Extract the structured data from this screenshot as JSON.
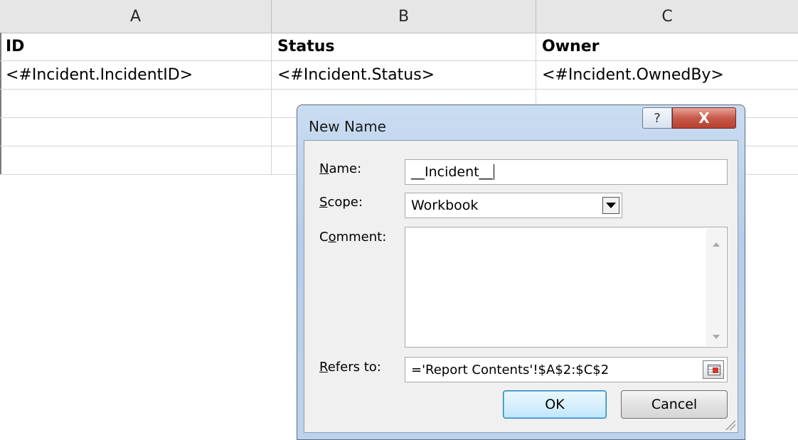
{
  "spreadsheet": {
    "columns": [
      "A",
      "B",
      "C"
    ],
    "header_row": [
      "ID",
      "Status",
      "Owner"
    ],
    "data_row": [
      "<#Incident.IncidentID>",
      "<#Incident.Status>",
      "<#Incident.OwnedBy>"
    ]
  },
  "dialog": {
    "title": "New Name",
    "help_glyph": "?",
    "close_glyph": "X",
    "name_label": {
      "accel": "N",
      "rest": "ame:"
    },
    "name_value": "__Incident__",
    "scope_label": {
      "accel": "S",
      "rest": "cope:"
    },
    "scope_value": "Workbook",
    "comment_label": {
      "pre": "C",
      "accel": "o",
      "rest": "mment:"
    },
    "comment_value": "",
    "refers_label": {
      "accel": "R",
      "rest": "efers to:"
    },
    "refers_value": "='Report Contents'!$A$2:$C$2",
    "ok_label": "OK",
    "cancel_label": "Cancel"
  },
  "icons": {
    "dropdown": "chevron-down-icon",
    "collapse_dialog": "range-select-icon",
    "resize": "resize-grip-icon"
  },
  "colors": {
    "header_bg": "#e6e6e6",
    "dialog_frame": "#b6cde9",
    "close_button": "#c75a49",
    "default_button": "#bee6fd"
  }
}
